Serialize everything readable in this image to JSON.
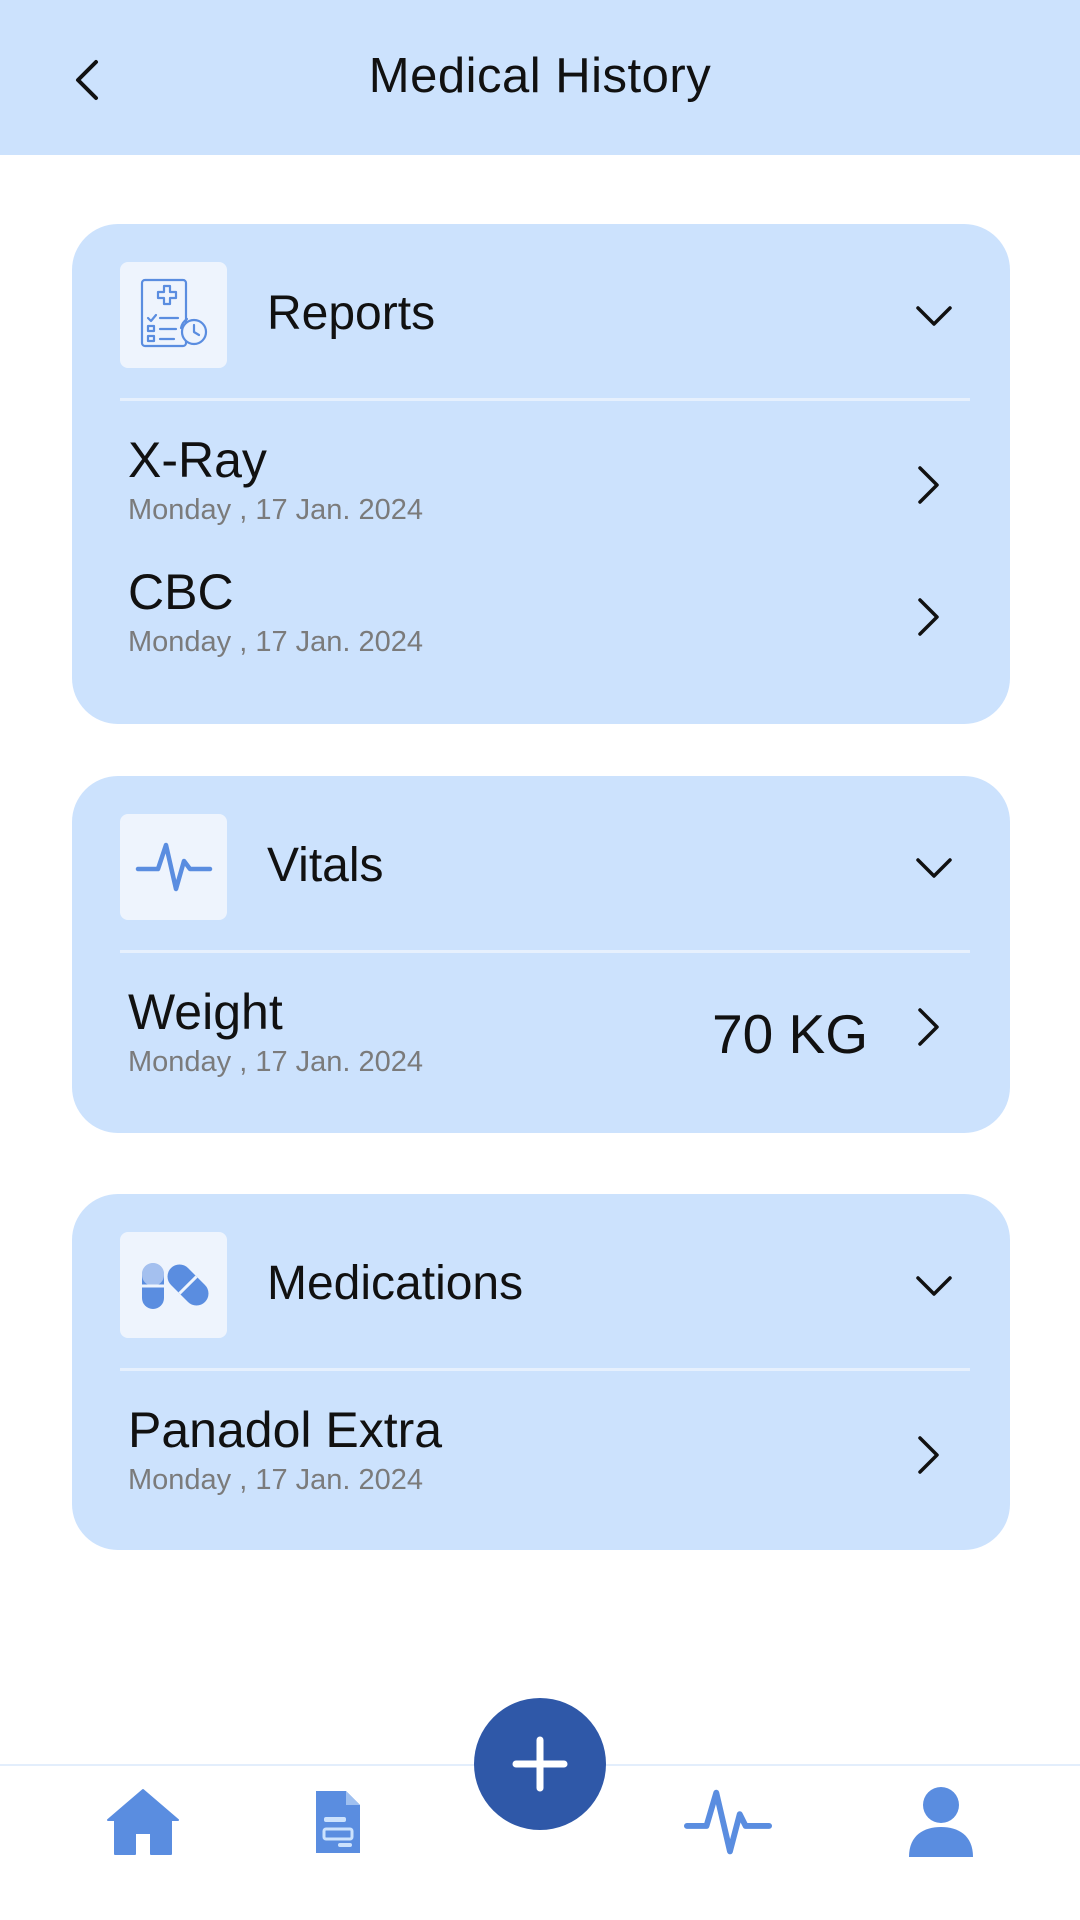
{
  "header": {
    "title": "Medical History",
    "back_icon": "chevron-left-icon"
  },
  "colors": {
    "accent": "#cce2fd",
    "icon": "#5a8de0",
    "fab": "#2f58a8",
    "muted_text": "#7b7b7b"
  },
  "sections": [
    {
      "title": "Reports",
      "icon": "report-clipboard-icon",
      "items": [
        {
          "title": "X-Ray",
          "date": "Monday , 17 Jan. 2024"
        },
        {
          "title": "CBC",
          "date": "Monday , 17 Jan. 2024"
        }
      ]
    },
    {
      "title": "Vitals",
      "icon": "heartbeat-icon",
      "items": [
        {
          "title": "Weight",
          "date": "Monday , 17 Jan. 2024",
          "value": "70 KG"
        }
      ]
    },
    {
      "title": "Medications",
      "icon": "pills-icon",
      "items": [
        {
          "title": "Panadol Extra",
          "date": "Monday , 17 Jan. 2024"
        }
      ]
    }
  ],
  "bottom_nav": {
    "items": [
      {
        "icon": "home-icon"
      },
      {
        "icon": "document-icon"
      },
      {
        "icon": "add-icon"
      },
      {
        "icon": "heartbeat-icon"
      },
      {
        "icon": "profile-icon"
      }
    ]
  }
}
